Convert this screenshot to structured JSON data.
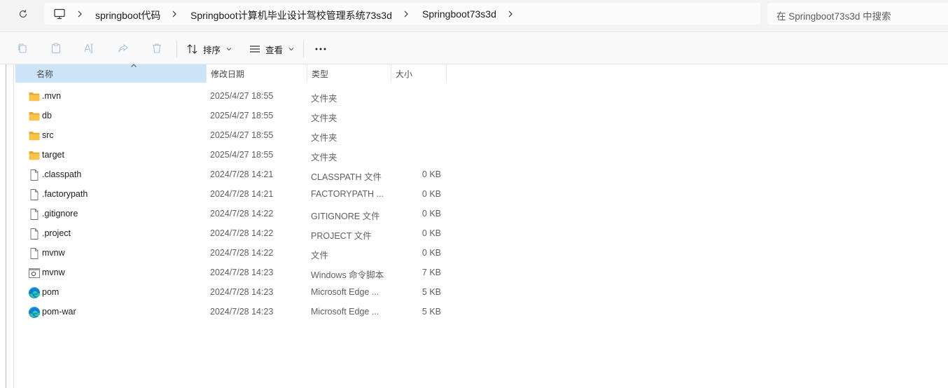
{
  "breadcrumb": [
    "springboot代码",
    "Springboot计算机毕业设计驾校管理系统73s3d",
    "Springboot73s3d"
  ],
  "search": {
    "placeholder": "在 Springboot73s3d 中搜索"
  },
  "toolbar": {
    "sort_label": "排序",
    "view_label": "查看",
    "more_label": "···"
  },
  "columns": {
    "name": "名称",
    "date": "修改日期",
    "type": "类型",
    "size": "大小"
  },
  "files": [
    {
      "name": ".mvn",
      "date": "2025/4/27 18:55",
      "type": "文件夹",
      "size": "",
      "icon": "folder-icon"
    },
    {
      "name": "db",
      "date": "2025/4/27 18:55",
      "type": "文件夹",
      "size": "",
      "icon": "folder-icon"
    },
    {
      "name": "src",
      "date": "2025/4/27 18:55",
      "type": "文件夹",
      "size": "",
      "icon": "folder-icon"
    },
    {
      "name": "target",
      "date": "2025/4/27 18:55",
      "type": "文件夹",
      "size": "",
      "icon": "folder-icon"
    },
    {
      "name": ".classpath",
      "date": "2024/7/28 14:21",
      "type": "CLASSPATH 文件",
      "size": "0 KB",
      "icon": "file-icon"
    },
    {
      "name": ".factorypath",
      "date": "2024/7/28 14:21",
      "type": "FACTORYPATH ...",
      "size": "0 KB",
      "icon": "file-icon"
    },
    {
      "name": ".gitignore",
      "date": "2024/7/28 14:22",
      "type": "GITIGNORE 文件",
      "size": "0 KB",
      "icon": "file-icon"
    },
    {
      "name": ".project",
      "date": "2024/7/28 14:22",
      "type": "PROJECT 文件",
      "size": "0 KB",
      "icon": "file-icon"
    },
    {
      "name": "mvnw",
      "date": "2024/7/28 14:22",
      "type": "文件",
      "size": "0 KB",
      "icon": "file-icon"
    },
    {
      "name": "mvnw",
      "date": "2024/7/28 14:23",
      "type": "Windows 命令脚本",
      "size": "7 KB",
      "icon": "script-icon"
    },
    {
      "name": "pom",
      "date": "2024/7/28 14:23",
      "type": "Microsoft Edge ...",
      "size": "5 KB",
      "icon": "edge-icon"
    },
    {
      "name": "pom-war",
      "date": "2024/7/28 14:23",
      "type": "Microsoft Edge ...",
      "size": "5 KB",
      "icon": "edge-icon"
    }
  ],
  "colors": {
    "selected_header": "#cce4f7",
    "folder": "#f8c34a",
    "accent": "#0067c0"
  }
}
